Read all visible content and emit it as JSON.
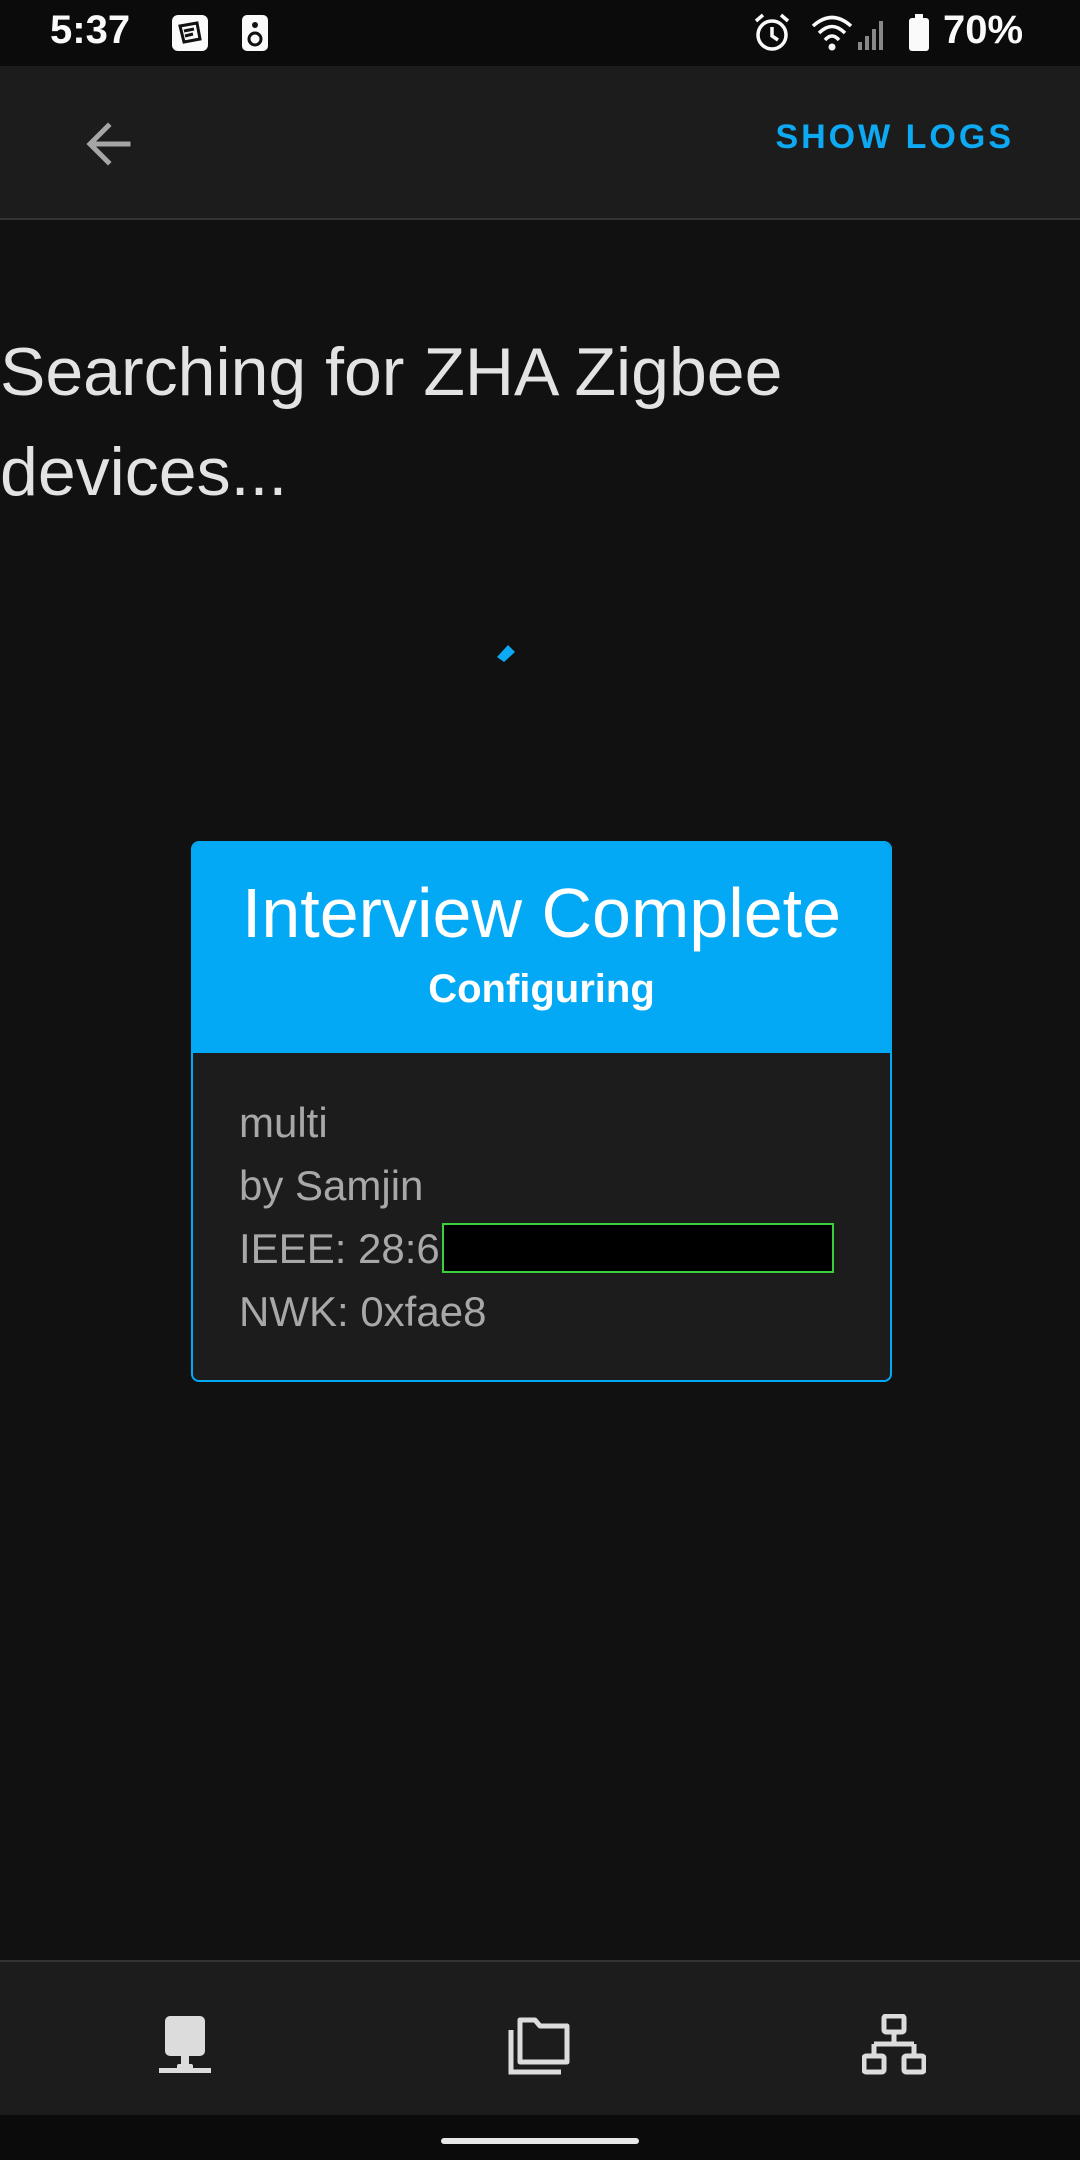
{
  "status_bar": {
    "time": "5:37",
    "notification_icons": [
      "tasker-icon",
      "speaker-icon"
    ],
    "right_icons": [
      "alarm-icon",
      "wifi-icon",
      "signal-icon",
      "battery-icon"
    ],
    "battery_text": "70%"
  },
  "app_bar": {
    "back_icon": "arrow-back-icon",
    "action_label": "SHOW LOGS",
    "accent": "#0da9f2"
  },
  "headline": "Searching for ZHA Zigbee devices...",
  "device_card": {
    "title": "Interview Complete",
    "subtitle": "Configuring",
    "header_color": "#03a9f4",
    "model": "multi",
    "manufacturer": "by Samjin",
    "ieee": "IEEE: 28:6",
    "nwk": "NWK: 0xfae8"
  },
  "bottom_nav": {
    "items": [
      "devices-icon",
      "folder-icon",
      "network-icon"
    ]
  }
}
